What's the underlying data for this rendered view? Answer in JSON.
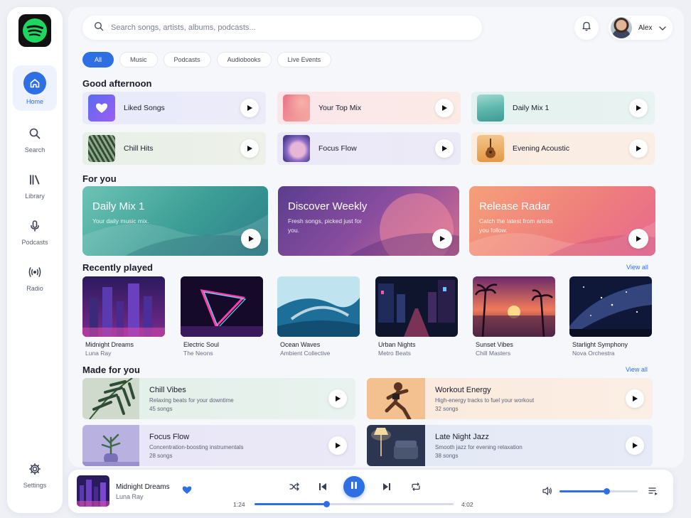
{
  "colors": {
    "accent": "#2f6fe4",
    "spotify_green": "#1ed760"
  },
  "sidebar": {
    "logo_icon": "spotify-logo",
    "items": [
      {
        "label": "Home",
        "icon": "home-icon",
        "active": true
      },
      {
        "label": "Search",
        "icon": "search-icon"
      },
      {
        "label": "Library",
        "icon": "library-icon"
      },
      {
        "label": "Podcasts",
        "icon": "microphone-icon"
      },
      {
        "label": "Radio",
        "icon": "radio-icon"
      }
    ],
    "settings_label": "Settings"
  },
  "header": {
    "search_placeholder": "Search songs, artists, albums, podcasts...",
    "user_name": "Alex"
  },
  "filters": [
    "All",
    "Music",
    "Podcasts",
    "Audiobooks",
    "Live Events"
  ],
  "greeting": "Good afternoon",
  "quick_picks": [
    {
      "label": "Liked Songs"
    },
    {
      "label": "Your Top Mix"
    },
    {
      "label": "Daily Mix 1"
    },
    {
      "label": "Chill Hits"
    },
    {
      "label": "Focus Flow"
    },
    {
      "label": "Evening Acoustic"
    }
  ],
  "for_you": {
    "title": "For you",
    "cards": [
      {
        "title": "Daily Mix 1",
        "subtitle": "Your daily music mix."
      },
      {
        "title": "Discover Weekly",
        "subtitle": "Fresh songs, picked just for you."
      },
      {
        "title": "Release Radar",
        "subtitle": "Catch the latest from artists you follow."
      }
    ]
  },
  "recently_played": {
    "title": "Recently played",
    "view_all": "View all",
    "items": [
      {
        "title": "Midnight Dreams",
        "artist": "Luna Ray"
      },
      {
        "title": "Electric Soul",
        "artist": "The Neons"
      },
      {
        "title": "Ocean Waves",
        "artist": "Ambient Collective"
      },
      {
        "title": "Urban Nights",
        "artist": "Metro Beats"
      },
      {
        "title": "Sunset Vibes",
        "artist": "Chill Masters"
      },
      {
        "title": "Starlight Symphony",
        "artist": "Nova Orchestra"
      }
    ]
  },
  "made_for_you": {
    "title": "Made for you",
    "view_all": "View all",
    "items": [
      {
        "title": "Chill Vibes",
        "desc": "Relaxing beats for your downtime",
        "count": "45 songs"
      },
      {
        "title": "Workout Energy",
        "desc": "High-energy tracks to fuel your workout",
        "count": "32 songs"
      },
      {
        "title": "Focus Flow",
        "desc": "Concentration-boosting instrumentals",
        "count": "28 songs"
      },
      {
        "title": "Late Night Jazz",
        "desc": "Smooth jazz for evening relaxation",
        "count": "38 songs"
      }
    ]
  },
  "player": {
    "title": "Midnight Dreams",
    "artist": "Luna Ray",
    "elapsed": "1:24",
    "duration": "4:02",
    "progress": 0.36,
    "volume": 0.6,
    "liked": true
  }
}
